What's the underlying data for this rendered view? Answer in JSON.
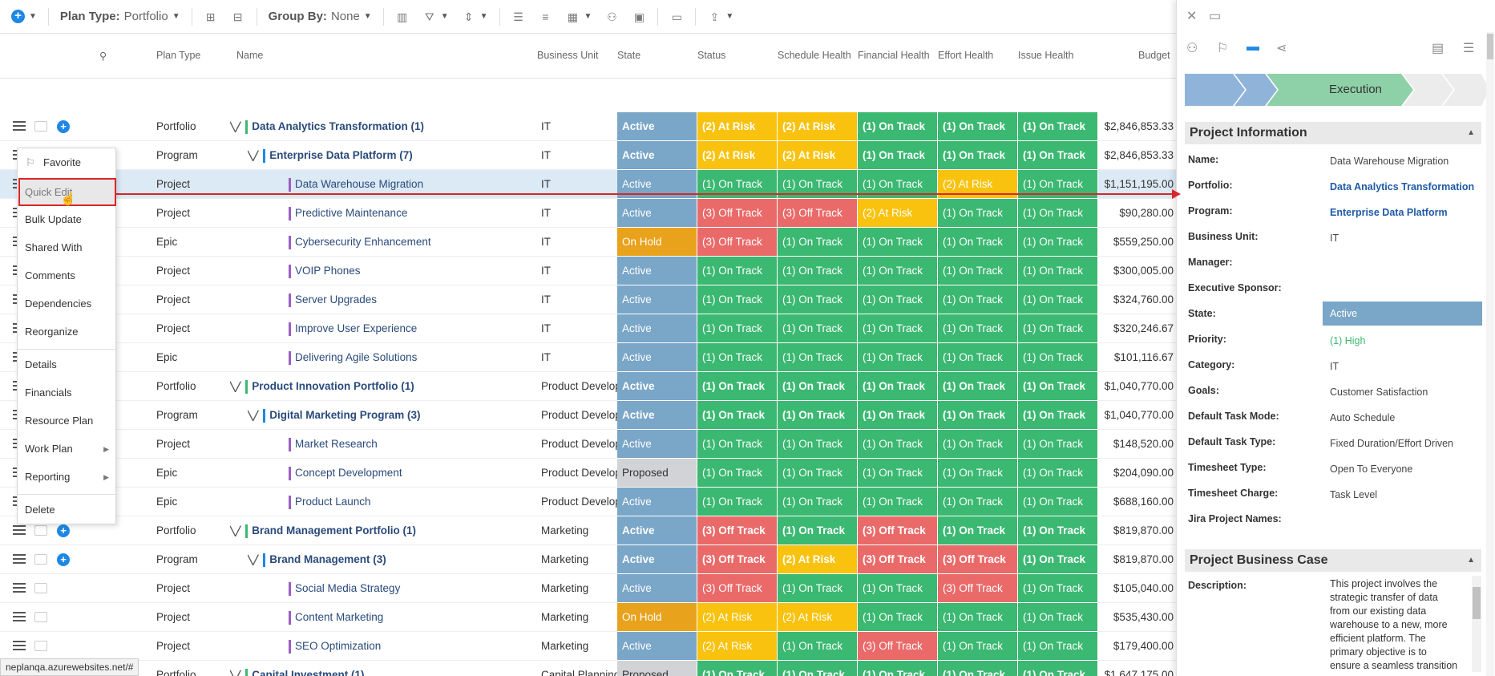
{
  "toolbar": {
    "plan_type_label": "Plan Type:",
    "plan_type_value": "Portfolio",
    "group_by_label": "Group By:",
    "group_by_value": "None"
  },
  "columns": {
    "plan_type": "Plan Type",
    "name": "Name",
    "business_unit": "Business Unit",
    "state": "State",
    "status": "Status",
    "schedule_health": "Schedule Health",
    "financial_health": "Financial Health",
    "effort_health": "Effort Health",
    "issue_health": "Issue Health",
    "budget": "Budget"
  },
  "rows": [
    {
      "plan_type": "Portfolio",
      "name": "Data Analytics Transformation (1)",
      "bu": "IT",
      "state": "Active",
      "status": "(2) At Risk",
      "schedule": "(2) At Risk",
      "financial": "(1) On Track",
      "effort": "(1) On Track",
      "issue": "(1) On Track",
      "budget": "$2,846,853.33"
    },
    {
      "plan_type": "Program",
      "name": "Enterprise Data Platform (7)",
      "bu": "IT",
      "state": "Active",
      "status": "(2) At Risk",
      "schedule": "(2) At Risk",
      "financial": "(1) On Track",
      "effort": "(1) On Track",
      "issue": "(1) On Track",
      "budget": "$2,846,853.33"
    },
    {
      "plan_type": "Project",
      "name": "Data Warehouse Migration",
      "bu": "IT",
      "state": "Active",
      "status": "(1) On Track",
      "schedule": "(1) On Track",
      "financial": "(1) On Track",
      "effort": "(2) At Risk",
      "issue": "(1) On Track",
      "budget": "$1,151,195.00"
    },
    {
      "plan_type": "Project",
      "name": "Predictive Maintenance",
      "bu": "IT",
      "state": "Active",
      "status": "(3) Off Track",
      "schedule": "(3) Off Track",
      "financial": "(2) At Risk",
      "effort": "(1) On Track",
      "issue": "(1) On Track",
      "budget": "$90,280.00"
    },
    {
      "plan_type": "Epic",
      "name": "Cybersecurity Enhancement",
      "bu": "IT",
      "state": "On Hold",
      "status": "(3) Off Track",
      "schedule": "(1) On Track",
      "financial": "(1) On Track",
      "effort": "(1) On Track",
      "issue": "(1) On Track",
      "budget": "$559,250.00"
    },
    {
      "plan_type": "Project",
      "name": "VOIP Phones",
      "bu": "IT",
      "state": "Active",
      "status": "(1) On Track",
      "schedule": "(1) On Track",
      "financial": "(1) On Track",
      "effort": "(1) On Track",
      "issue": "(1) On Track",
      "budget": "$300,005.00"
    },
    {
      "plan_type": "Project",
      "name": "Server Upgrades",
      "bu": "IT",
      "state": "Active",
      "status": "(1) On Track",
      "schedule": "(1) On Track",
      "financial": "(1) On Track",
      "effort": "(1) On Track",
      "issue": "(1) On Track",
      "budget": "$324,760.00"
    },
    {
      "plan_type": "Project",
      "name": "Improve User Experience",
      "bu": "IT",
      "state": "Active",
      "status": "(1) On Track",
      "schedule": "(1) On Track",
      "financial": "(1) On Track",
      "effort": "(1) On Track",
      "issue": "(1) On Track",
      "budget": "$320,246.67"
    },
    {
      "plan_type": "Epic",
      "name": "Delivering Agile Solutions",
      "bu": "IT",
      "state": "Active",
      "status": "(1) On Track",
      "schedule": "(1) On Track",
      "financial": "(1) On Track",
      "effort": "(1) On Track",
      "issue": "(1) On Track",
      "budget": "$101,116.67"
    },
    {
      "plan_type": "Portfolio",
      "name": "Product Innovation Portfolio (1)",
      "bu": "Product Develop",
      "state": "Active",
      "status": "(1) On Track",
      "schedule": "(1) On Track",
      "financial": "(1) On Track",
      "effort": "(1) On Track",
      "issue": "(1) On Track",
      "budget": "$1,040,770.00"
    },
    {
      "plan_type": "Program",
      "name": "Digital Marketing Program (3)",
      "bu": "Product Develop",
      "state": "Active",
      "status": "(1) On Track",
      "schedule": "(1) On Track",
      "financial": "(1) On Track",
      "effort": "(1) On Track",
      "issue": "(1) On Track",
      "budget": "$1,040,770.00"
    },
    {
      "plan_type": "Project",
      "name": "Market Research",
      "bu": "Product Develop",
      "state": "Active",
      "status": "(1) On Track",
      "schedule": "(1) On Track",
      "financial": "(1) On Track",
      "effort": "(1) On Track",
      "issue": "(1) On Track",
      "budget": "$148,520.00"
    },
    {
      "plan_type": "Epic",
      "name": "Concept Development",
      "bu": "Product Develop",
      "state": "Proposed",
      "status": "(1) On Track",
      "schedule": "(1) On Track",
      "financial": "(1) On Track",
      "effort": "(1) On Track",
      "issue": "(1) On Track",
      "budget": "$204,090.00"
    },
    {
      "plan_type": "Epic",
      "name": "Product Launch",
      "bu": "Product Develop",
      "state": "Active",
      "status": "(1) On Track",
      "schedule": "(1) On Track",
      "financial": "(1) On Track",
      "effort": "(1) On Track",
      "issue": "(1) On Track",
      "budget": "$688,160.00"
    },
    {
      "plan_type": "Portfolio",
      "name": "Brand Management Portfolio (1)",
      "bu": "Marketing",
      "state": "Active",
      "status": "(3) Off Track",
      "schedule": "(1) On Track",
      "financial": "(3) Off Track",
      "effort": "(1) On Track",
      "issue": "(1) On Track",
      "budget": "$819,870.00"
    },
    {
      "plan_type": "Program",
      "name": "Brand Management (3)",
      "bu": "Marketing",
      "state": "Active",
      "status": "(3) Off Track",
      "schedule": "(2) At Risk",
      "financial": "(3) Off Track",
      "effort": "(3) Off Track",
      "issue": "(1) On Track",
      "budget": "$819,870.00"
    },
    {
      "plan_type": "Project",
      "name": "Social Media Strategy",
      "bu": "Marketing",
      "state": "Active",
      "status": "(3) Off Track",
      "schedule": "(1) On Track",
      "financial": "(1) On Track",
      "effort": "(3) Off Track",
      "issue": "(1) On Track",
      "budget": "$105,040.00"
    },
    {
      "plan_type": "Project",
      "name": "Content Marketing",
      "bu": "Marketing",
      "state": "On Hold",
      "status": "(2) At Risk",
      "schedule": "(2) At Risk",
      "financial": "(1) On Track",
      "effort": "(1) On Track",
      "issue": "(1) On Track",
      "budget": "$535,430.00"
    },
    {
      "plan_type": "Project",
      "name": "SEO Optimization",
      "bu": "Marketing",
      "state": "Active",
      "status": "(2) At Risk",
      "schedule": "(1) On Track",
      "financial": "(3) Off Track",
      "effort": "(1) On Track",
      "issue": "(1) On Track",
      "budget": "$179,400.00"
    },
    {
      "plan_type": "Portfolio",
      "name": "Capital Investment (1)",
      "bu": "Capital Planning",
      "state": "Proposed",
      "status": "(1) On Track",
      "schedule": "(1) On Track",
      "financial": "(1) On Track",
      "effort": "(1) On Track",
      "issue": "(1) On Track",
      "budget": "$1,647,175.00"
    }
  ],
  "context_menu": {
    "favorite": "Favorite",
    "quick_edit": "Quick Edit",
    "bulk_update": "Bulk Update",
    "shared_with": "Shared With",
    "comments": "Comments",
    "dependencies": "Dependencies",
    "reorganize": "Reorganize",
    "details": "Details",
    "financials": "Financials",
    "resource_plan": "Resource Plan",
    "work_plan": "Work Plan",
    "reporting": "Reporting",
    "delete": "Delete"
  },
  "status_url": "neplanqa.azurewebsites.net/#",
  "panel": {
    "stage_current": "Execution",
    "project_info_title": "Project Information",
    "fields": {
      "name_label": "Name:",
      "name_value": "Data Warehouse Migration",
      "portfolio_label": "Portfolio:",
      "portfolio_value": "Data Analytics Transformation",
      "program_label": "Program:",
      "program_value": "Enterprise Data Platform",
      "bu_label": "Business Unit:",
      "bu_value": "IT",
      "manager_label": "Manager:",
      "sponsor_label": "Executive Sponsor:",
      "state_label": "State:",
      "state_value": "Active",
      "priority_label": "Priority:",
      "priority_value": "(1) High",
      "category_label": "Category:",
      "category_value": "IT",
      "goals_label": "Goals:",
      "goals_value": "Customer Satisfaction",
      "task_mode_label": "Default Task Mode:",
      "task_mode_value": "Auto Schedule",
      "task_type_label": "Default Task Type:",
      "task_type_value": "Fixed Duration/Effort Driven",
      "timesheet_type_label": "Timesheet Type:",
      "timesheet_type_value": "Open To Everyone",
      "timesheet_charge_label": "Timesheet Charge:",
      "timesheet_charge_value": "Task Level",
      "jira_label": "Jira Project Names:"
    },
    "business_case_title": "Project Business Case",
    "description_label": "Description:",
    "description_value": "This project involves the strategic transfer of data from our existing data warehouse to a new, more efficient platform. The primary objective is to ensure a seamless transition"
  },
  "colors": {
    "active": "#7aa6c8",
    "on_hold": "#e8a21c",
    "proposed": "#d1d3d6",
    "on_track": "#3bb871",
    "at_risk": "#f9c20f",
    "off_track": "#ea6a6a",
    "accent": "#1e88e5",
    "highlight": "#d9262c"
  }
}
